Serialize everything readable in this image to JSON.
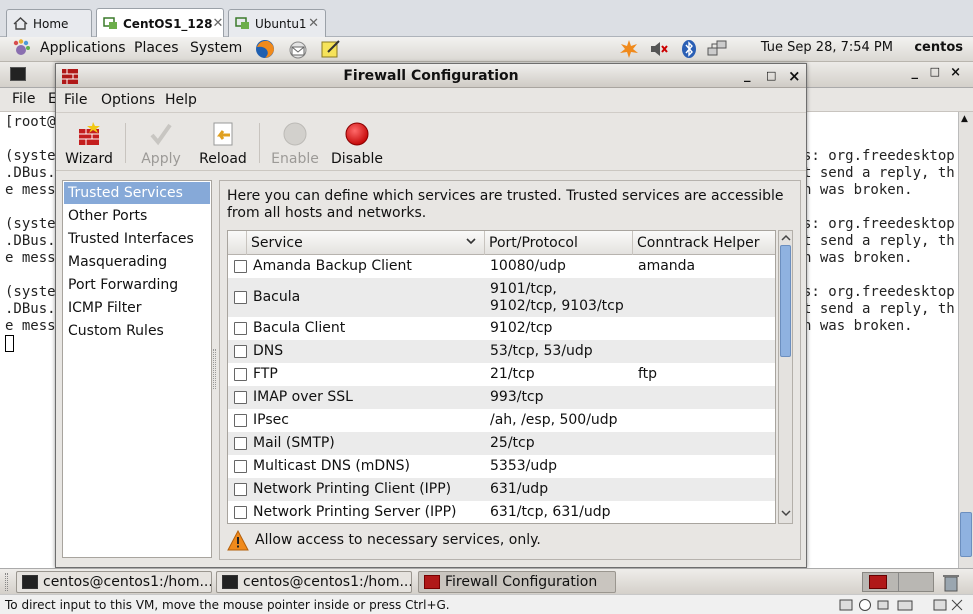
{
  "vm_tabs": [
    {
      "label": "Home",
      "closable": false
    },
    {
      "label": "CentOS1_128",
      "closable": true,
      "active": true
    },
    {
      "label": "Ubuntu1",
      "closable": true
    }
  ],
  "panel": {
    "menus": [
      "Applications",
      "Places",
      "System"
    ],
    "clock": "Tue Sep 28,  7:54 PM",
    "user": "centos"
  },
  "terminal": {
    "menu": [
      "File",
      "E"
    ],
    "lines_left": [
      "[root@",
      "",
      "(syste",
      ".DBus.",
      "e mess",
      "",
      "(syste",
      ".DBus.",
      "e mess",
      "",
      "(syste",
      ".DBus.",
      "e mess"
    ],
    "lines_right": [
      "",
      "",
      "s: org.freedesktop",
      "t send a reply, th",
      "n was broken.",
      "",
      "s: org.freedesktop",
      "t send a reply, th",
      "n was broken.",
      "",
      "s: org.freedesktop",
      "t send a reply, th",
      "n was broken."
    ]
  },
  "firewall": {
    "title": "Firewall Configuration",
    "window_buttons": [
      "_",
      "□",
      "×"
    ],
    "menu": [
      "File",
      "Options",
      "Help"
    ],
    "toolbar": [
      {
        "label": "Wizard",
        "enabled": true,
        "icon": "wizard-icon"
      },
      {
        "label": "Apply",
        "enabled": false,
        "icon": "check-icon"
      },
      {
        "label": "Reload",
        "enabled": true,
        "icon": "reload-icon"
      },
      {
        "label": "Enable",
        "enabled": false,
        "icon": "grey-circle-icon"
      },
      {
        "label": "Disable",
        "enabled": true,
        "icon": "red-circle-icon"
      }
    ],
    "sidebar": [
      "Trusted Services",
      "Other Ports",
      "Trusted Interfaces",
      "Masquerading",
      "Port Forwarding",
      "ICMP Filter",
      "Custom Rules"
    ],
    "selected_sidebar": "Trusted Services",
    "description": "Here you can define which services are trusted. Trusted services are accessible from all hosts and networks.",
    "columns": [
      "Service",
      "Port/Protocol",
      "Conntrack Helper"
    ],
    "services": [
      {
        "service": "Amanda Backup Client",
        "port": "10080/udp",
        "helper": "amanda",
        "checked": false
      },
      {
        "service": "Bacula",
        "port": "9101/tcp, 9102/tcp, 9103/tcp",
        "helper": "",
        "checked": false
      },
      {
        "service": "Bacula Client",
        "port": "9102/tcp",
        "helper": "",
        "checked": false
      },
      {
        "service": "DNS",
        "port": "53/tcp, 53/udp",
        "helper": "",
        "checked": false
      },
      {
        "service": "FTP",
        "port": "21/tcp",
        "helper": "ftp",
        "checked": false
      },
      {
        "service": "IMAP over SSL",
        "port": "993/tcp",
        "helper": "",
        "checked": false
      },
      {
        "service": "IPsec",
        "port": "/ah, /esp, 500/udp",
        "helper": "",
        "checked": false
      },
      {
        "service": "Mail (SMTP)",
        "port": "25/tcp",
        "helper": "",
        "checked": false
      },
      {
        "service": "Multicast DNS (mDNS)",
        "port": "5353/udp",
        "helper": "",
        "checked": false
      },
      {
        "service": "Network Printing Client (IPP)",
        "port": "631/udp",
        "helper": "",
        "checked": false
      },
      {
        "service": "Network Printing Server (IPP)",
        "port": "631/tcp, 631/udp",
        "helper": "",
        "checked": false
      }
    ],
    "warning": "Allow access to necessary services, only."
  },
  "taskbar": [
    {
      "label": "centos@centos1:/hom...",
      "icon": "terminal-icon"
    },
    {
      "label": "centos@centos1:/hom...",
      "icon": "terminal-icon"
    },
    {
      "label": "Firewall Configuration",
      "icon": "firewall-icon",
      "active": true
    }
  ],
  "statusbar": {
    "text": "To direct input to this VM, move the mouse pointer inside or press Ctrl+G."
  },
  "colors": {
    "selection": "#86a9d8",
    "disable_red": "#e01010",
    "warning_orange": "#f08a1c"
  }
}
